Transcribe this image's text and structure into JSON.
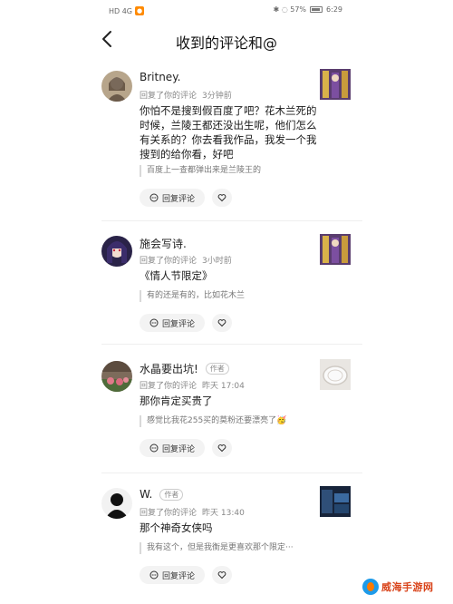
{
  "status_bar": {
    "left_text": "HD 4G",
    "left_badge": "●",
    "right_text": "✱ ◌ 57%",
    "time": "6:29"
  },
  "nav": {
    "title": "收到的评论和@"
  },
  "items": [
    {
      "name": "Britney.",
      "author_tag": "",
      "action": "回复了你的评论",
      "time": "3分钟前",
      "reply": "你怕不是搜到假百度了吧？花木兰死的时候，兰陵王都还没出生呢，他们怎么有关系的？你去看我作品，我发一个我搜到的给你看，好吧",
      "quote": "百度上一查都弹出来是兰陵王的",
      "reply_btn": "回复评论"
    },
    {
      "name": "施会写诗.",
      "author_tag": "",
      "action": "回复了你的评论",
      "time": "3小时前",
      "reply": "《情人节限定》",
      "quote": "有的还是有的，比如花木兰",
      "reply_btn": "回复评论"
    },
    {
      "name": "水晶要出坑!",
      "author_tag": "作者",
      "action": "回复了你的评论",
      "time": "昨天 17:04",
      "reply": "那你肯定买贵了",
      "quote": "感觉比我花255买的莫粉还要漂亮了🥳",
      "reply_btn": "回复评论"
    },
    {
      "name": "W.",
      "author_tag": "作者",
      "action": "回复了你的评论",
      "time": "昨天 13:40",
      "reply": "那个神奇女侠吗",
      "quote": "我有这个，但是我衡是更喜欢那个限定···",
      "reply_btn": "回复评论"
    }
  ],
  "watermark": {
    "text": "威海手游网"
  }
}
